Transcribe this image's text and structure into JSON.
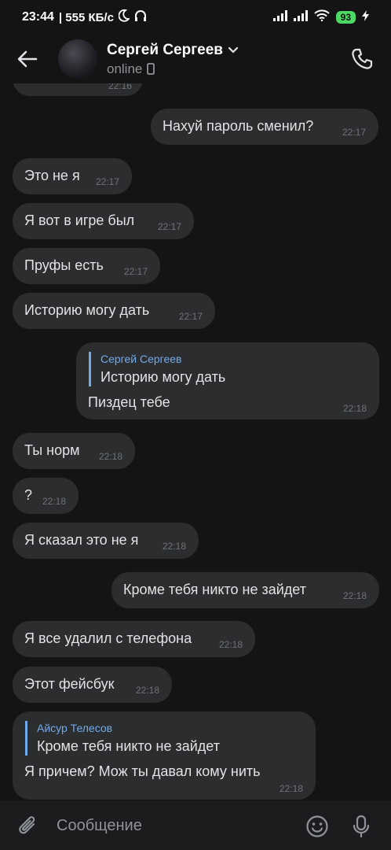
{
  "statusbar": {
    "time": "23:44",
    "speed": "| 555 КБ/с",
    "battery": "93"
  },
  "header": {
    "name": "Сергей Сергеев",
    "status": "online"
  },
  "messages": [
    {
      "dir": "in",
      "text": "",
      "time": "22:16"
    },
    {
      "dir": "out",
      "text": "Нахуй пароль сменил?",
      "time": "22:17"
    },
    {
      "dir": "in",
      "text": "Это не я",
      "time": "22:17"
    },
    {
      "dir": "in",
      "text": "Я вот в игре был",
      "time": "22:17"
    },
    {
      "dir": "in",
      "text": "Пруфы есть",
      "time": "22:17"
    },
    {
      "dir": "in",
      "text": "Историю могу дать",
      "time": "22:17"
    },
    {
      "dir": "out",
      "reply_name": "Сергей Сергеев",
      "reply_text": "Историю могу дать",
      "text": "Пиздец тебе",
      "time": "22:18"
    },
    {
      "dir": "in",
      "text": "Ты норм",
      "time": "22:18"
    },
    {
      "dir": "in",
      "text": "?",
      "time": "22:18"
    },
    {
      "dir": "in",
      "text": "Я сказал это не я",
      "time": "22:18"
    },
    {
      "dir": "out",
      "text": "Кроме тебя никто не зайдет",
      "time": "22:18"
    },
    {
      "dir": "in",
      "text": "Я все удалил с телефона",
      "time": "22:18"
    },
    {
      "dir": "in",
      "text": "Этот фейсбук",
      "time": "22:18"
    },
    {
      "dir": "in",
      "reply_name": "Айсур Телесов",
      "reply_text": "Кроме тебя никто не зайдет",
      "text": "Я причем? Мож ты давал кому нить",
      "time": "22:18"
    }
  ],
  "composer": {
    "placeholder": "Сообщение"
  },
  "icons": {
    "back": "arrow-left",
    "call": "phone",
    "attach": "paperclip",
    "emoji": "smile",
    "mic": "microphone"
  }
}
